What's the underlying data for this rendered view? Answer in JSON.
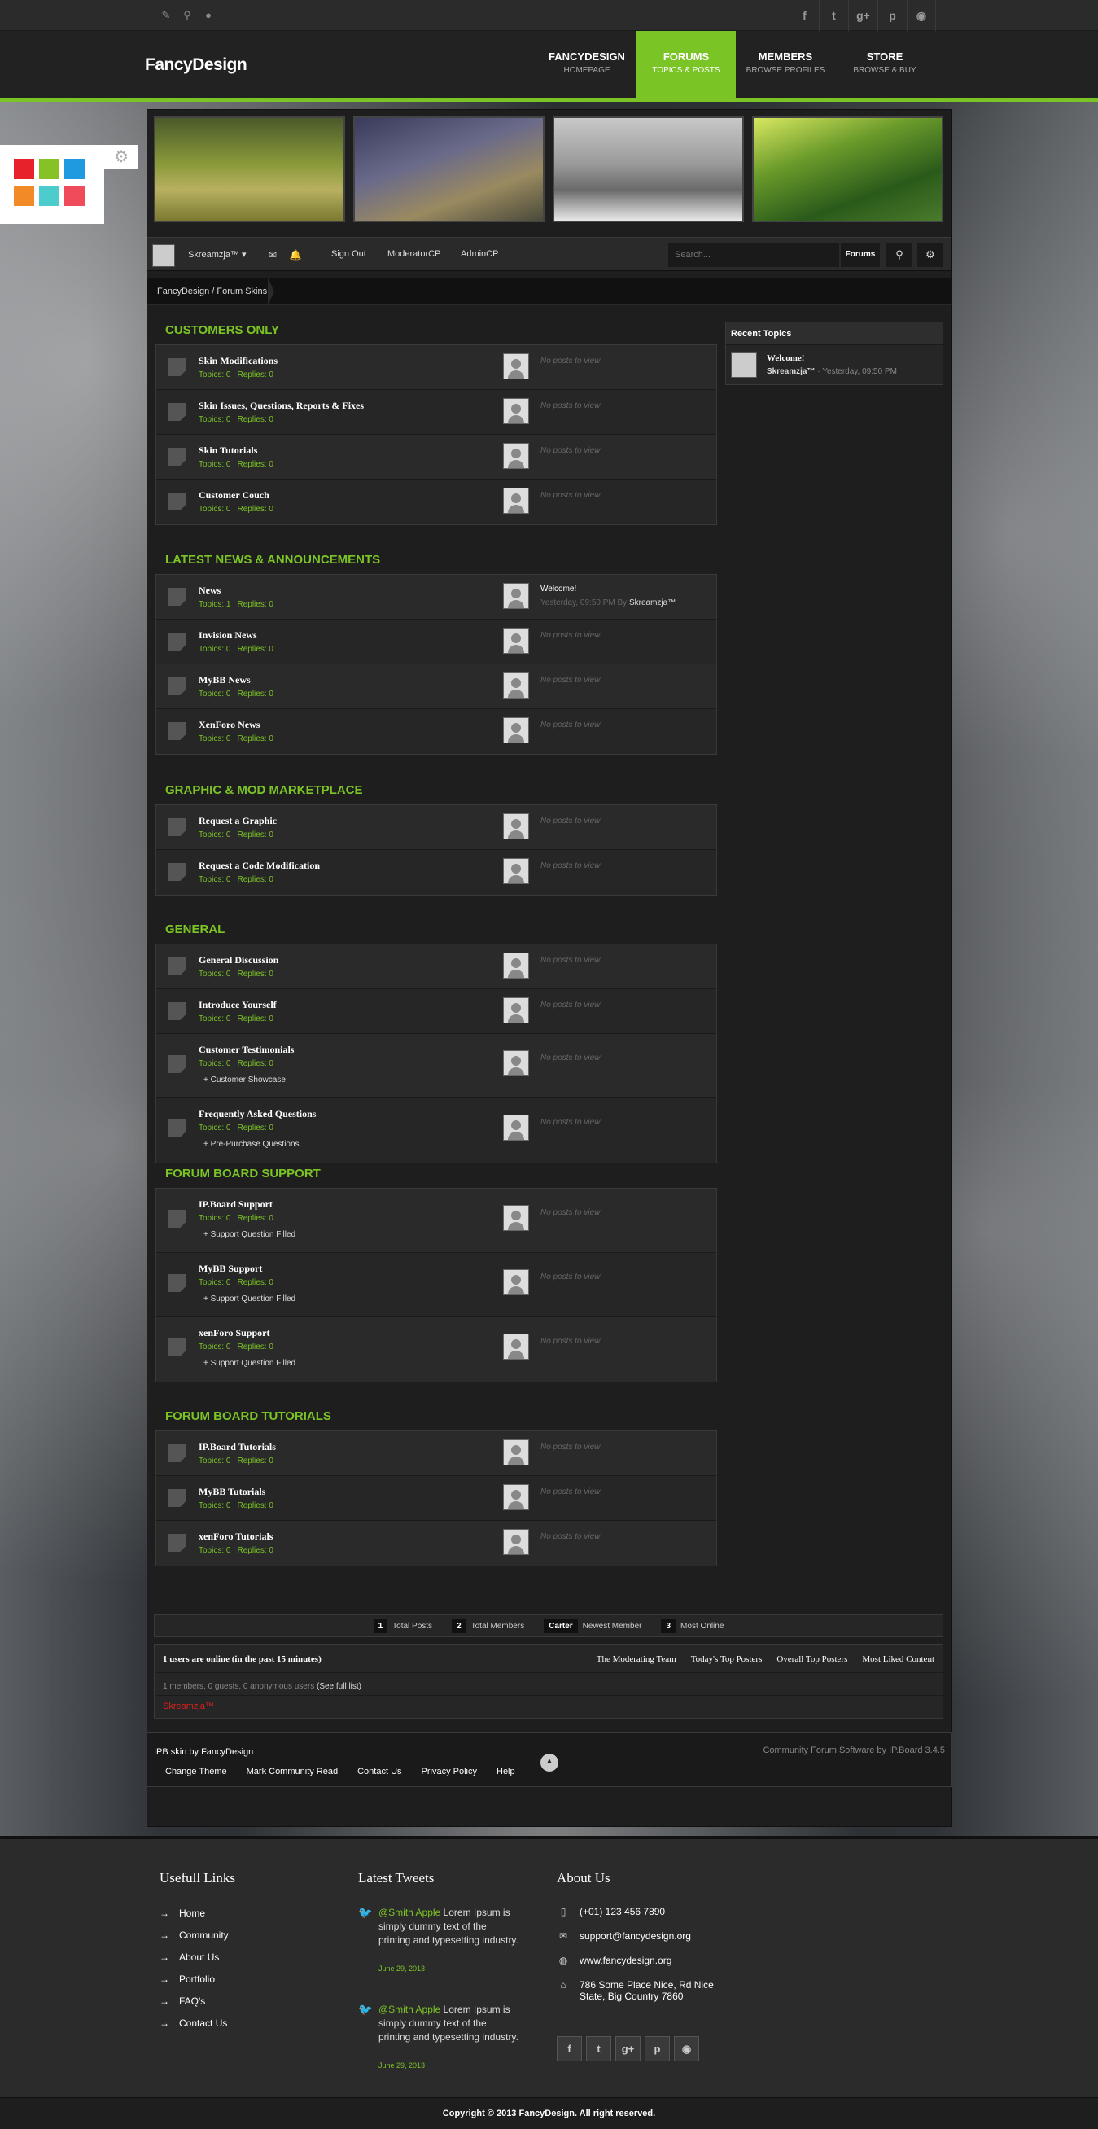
{
  "topbar": {
    "left_icons": [
      "edit-icon",
      "location-icon",
      "chat-icon"
    ],
    "social": [
      {
        "name": "facebook-icon",
        "glyph": "f"
      },
      {
        "name": "twitter-icon",
        "glyph": "t"
      },
      {
        "name": "googleplus-icon",
        "glyph": "g+"
      },
      {
        "name": "pinterest-icon",
        "glyph": "p"
      },
      {
        "name": "rss-icon",
        "glyph": "◉"
      }
    ]
  },
  "header": {
    "logo": "FancyDesign",
    "nav": [
      {
        "title": "FANCYDESIGN",
        "sub": "HOMEPAGE"
      },
      {
        "title": "FORUMS",
        "sub": "TOPICS & POSTS",
        "active": true
      },
      {
        "title": "MEMBERS",
        "sub": "BROWSE PROFILES"
      },
      {
        "title": "STORE",
        "sub": "BROWSE & BUY"
      }
    ],
    "accent": "#7bc426"
  },
  "palette": {
    "colors": [
      "#e8222a",
      "#86c226",
      "#1e9be0",
      "#f38a28",
      "#4ccccc",
      "#ef4b5b"
    ]
  },
  "gallery": [
    "photo-tree-meadow",
    "photo-grass",
    "photo-snow-forest",
    "photo-green-forest"
  ],
  "toolbar": {
    "user": "Skreamzja™",
    "signout": "Sign Out",
    "modcp": "ModeratorCP",
    "admincp": "AdminCP",
    "search_placeholder": "Search...",
    "forums": "Forums"
  },
  "breadcrumb": "FancyDesign / Forum Skins",
  "categories": [
    {
      "title": "CUSTOMERS ONLY",
      "forums": [
        {
          "name": "Skin Modifications",
          "topics": "0",
          "replies": "0"
        },
        {
          "name": "Skin Issues, Questions, Reports & Fixes",
          "topics": "0",
          "replies": "0"
        },
        {
          "name": "Skin Tutorials",
          "topics": "0",
          "replies": "0"
        },
        {
          "name": "Customer Couch",
          "topics": "0",
          "replies": "0"
        }
      ]
    },
    {
      "title": "LATEST NEWS & ANNOUNCEMENTS",
      "forums": [
        {
          "name": "News",
          "topics": "1",
          "replies": "0",
          "last_title": "Welcome!",
          "last_time": "Yesterday, 09:50 PM",
          "last_by": "By",
          "last_user": "Skreamzja™"
        },
        {
          "name": "Invision News",
          "topics": "0",
          "replies": "0"
        },
        {
          "name": "MyBB News",
          "topics": "0",
          "replies": "0"
        },
        {
          "name": "XenForo News",
          "topics": "0",
          "replies": "0"
        }
      ]
    },
    {
      "title": "GRAPHIC & MOD MARKETPLACE",
      "forums": [
        {
          "name": "Request a Graphic",
          "topics": "0",
          "replies": "0"
        },
        {
          "name": "Request a Code Modification",
          "topics": "0",
          "replies": "0"
        }
      ]
    },
    {
      "title": "GENERAL",
      "forums": [
        {
          "name": "General Discussion",
          "topics": "0",
          "replies": "0"
        },
        {
          "name": "Introduce Yourself",
          "topics": "0",
          "replies": "0"
        },
        {
          "name": "Customer Testimonials",
          "topics": "0",
          "replies": "0",
          "sub": "+ Customer Showcase"
        },
        {
          "name": "Frequently Asked Questions",
          "topics": "0",
          "replies": "0",
          "sub": "+ Pre-Purchase Questions"
        }
      ]
    },
    {
      "title": "FORUM BOARD SUPPORT",
      "forums": [
        {
          "name": "IP.Board Support",
          "topics": "0",
          "replies": "0",
          "sub": "+ Support Question Filled"
        },
        {
          "name": "MyBB Support",
          "topics": "0",
          "replies": "0",
          "sub": "+ Support Question Filled"
        },
        {
          "name": "xenForo Support",
          "topics": "0",
          "replies": "0",
          "sub": "+ Support Question Filled"
        }
      ]
    },
    {
      "title": "FORUM BOARD TUTORIALS",
      "forums": [
        {
          "name": "IP.Board Tutorials",
          "topics": "0",
          "replies": "0"
        },
        {
          "name": "MyBB Tutorials",
          "topics": "0",
          "replies": "0"
        },
        {
          "name": "xenForo Tutorials",
          "topics": "0",
          "replies": "0"
        }
      ]
    }
  ],
  "labels": {
    "topics": "Topics:",
    "replies": "Replies:",
    "no_posts": "No posts to view"
  },
  "sidebar": {
    "title": "Recent Topics",
    "topic": "Welcome!",
    "user": "Skreamzja™",
    "time": "· Yesterday, 09:50 PM"
  },
  "stats": [
    {
      "n": "1",
      "label": "Total Posts"
    },
    {
      "n": "2",
      "label": "Total Members"
    },
    {
      "n": "Carter",
      "label": "Newest Member"
    },
    {
      "n": "3",
      "label": "Most Online"
    }
  ],
  "online": {
    "heading": "1 users are online (in the past 15 minutes)",
    "links": [
      "The Moderating Team",
      "Today's Top Posters",
      "Overall Top Posters",
      "Most Liked Content"
    ],
    "sub": "1 members, 0 guests, 0 anonymous users",
    "full_list": "(See full list)",
    "who": "Skreamzja™"
  },
  "board_footer": {
    "left": "IPB skin by FancyDesign",
    "right": "Community Forum Software by IP.Board 3.4.5",
    "links": [
      "Change Theme",
      "Mark Community Read",
      "Contact Us",
      "Privacy Policy",
      "Help"
    ]
  },
  "footer": {
    "useful_title": "Usefull Links",
    "useful": [
      "Home",
      "Community",
      "About Us",
      "Portfolio",
      "FAQ's",
      "Contact Us"
    ],
    "tweets_title": "Latest Tweets",
    "tweets": [
      {
        "handle": "@Smith Apple",
        "text": "Lorem Ipsum is simply dummy text of the printing and typesetting industry.",
        "date": "June 29, 2013"
      },
      {
        "handle": "@Smith Apple",
        "text": "Lorem Ipsum is simply dummy text of the printing and typesetting industry.",
        "date": "June 29, 2013"
      }
    ],
    "about_title": "About Us",
    "about": [
      {
        "icon": "phone-icon",
        "glyph": "▯",
        "text": "(+01) 123 456 7890"
      },
      {
        "icon": "mail-icon",
        "glyph": "✉",
        "text": "support@fancydesign.org"
      },
      {
        "icon": "globe-icon",
        "glyph": "◍",
        "text": "www.fancydesign.org"
      },
      {
        "icon": "home-icon",
        "glyph": "⌂",
        "text": "786 Some Place Nice, Rd Nice",
        "text2": "State, Big Country 7860"
      }
    ],
    "copyright": "Copyright © 2013 FancyDesign. All right reserved."
  }
}
